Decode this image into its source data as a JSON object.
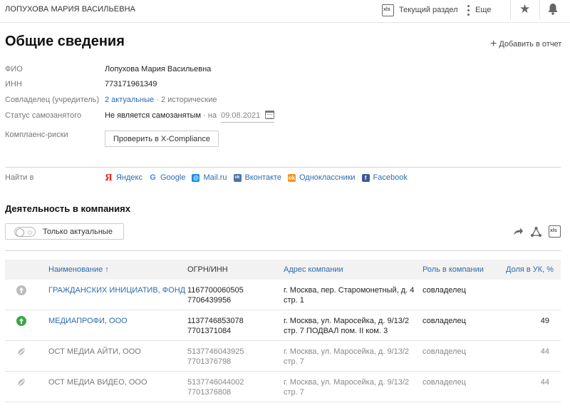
{
  "header": {
    "person_name": "ЛОПУХОВА МАРИЯ ВАСИЛЬЕВНА",
    "current_section_label": "Текущий раздел",
    "more_label": "Еще"
  },
  "page": {
    "title": "Общие сведения",
    "add_to_report_label": "Добавить в отчет"
  },
  "fields": {
    "fio_label": "ФИО",
    "fio_value": "Лопухова Мария Васильевна",
    "inn_label": "ИНН",
    "inn_value": "773171961349",
    "coowner_label": "Совладелец (учредитель)",
    "coowner_actual": "2 актуальные",
    "coowner_sep": "·",
    "coowner_historical": "2 исторические",
    "selfemployed_label": "Статус самозанятого",
    "selfemployed_value": "Не является самозанятым",
    "selfemployed_on": "· на",
    "selfemployed_date": "09.08.2021",
    "compliance_label": "Комплаенс-риски",
    "compliance_button": "Проверить в X-Compliance"
  },
  "find": {
    "label": "Найти в",
    "links": [
      {
        "label": "Яндекс",
        "icon": "yandex-icon",
        "color": "#e52620"
      },
      {
        "label": "Google",
        "icon": "google-icon",
        "color": "#4285f4"
      },
      {
        "label": "Mail.ru",
        "icon": "mailru-icon",
        "color": "#168de2"
      },
      {
        "label": "Вконтакте",
        "icon": "vk-icon",
        "color": "#4a76a8"
      },
      {
        "label": "Одноклассники",
        "icon": "ok-icon",
        "color": "#f7931e"
      },
      {
        "label": "Facebook",
        "icon": "facebook-icon",
        "color": "#3b5998"
      }
    ]
  },
  "activity": {
    "title": "Деятельность в компаниях",
    "toggle_label": "Только актуальные",
    "columns": {
      "name": "Наименование ↑",
      "ogrn": "ОГРН/ИНН",
      "address": "Адрес компании",
      "role": "Роль в компании",
      "share": "Доля в УК, %"
    },
    "rows": [
      {
        "status": "gray",
        "name": "ГРАЖДАНСКИХ ИНИЦИАТИВ, ФОНД",
        "ogrn": "1167700060505",
        "inn": "7706439956",
        "addr1": "г. Москва, пер. Старомонетный, д. 4",
        "addr2": "стр. 1",
        "role": "совладелец",
        "share": ""
      },
      {
        "status": "green",
        "name": "МЕДИАПРОФИ, ООО",
        "ogrn": "1137746853078",
        "inn": "7701371084",
        "addr1": "г. Москва, ул. Маросейка, д. 9/13/2",
        "addr2": "стр. 7 ПОДВАЛ пом. II ком. 3",
        "role": "совладелец",
        "share": "49"
      },
      {
        "status": "liquidated",
        "name": "ОСТ МЕДИА АЙТИ, ООО",
        "ogrn": "5137746043925",
        "inn": "7701376798",
        "addr1": "г. Москва, ул. Маросейка, д. 9/13/2",
        "addr2": "стр. 7",
        "role": "совладелец",
        "share": "44"
      },
      {
        "status": "liquidated",
        "name": "ОСТ МЕДИА ВИДЕО, ООО",
        "ogrn": "5137746044002",
        "inn": "7701376808",
        "addr1": "г. Москва, ул. Маросейка, д. 9/13/2",
        "addr2": "стр. 7",
        "role": "совладелец",
        "share": "44"
      }
    ]
  }
}
